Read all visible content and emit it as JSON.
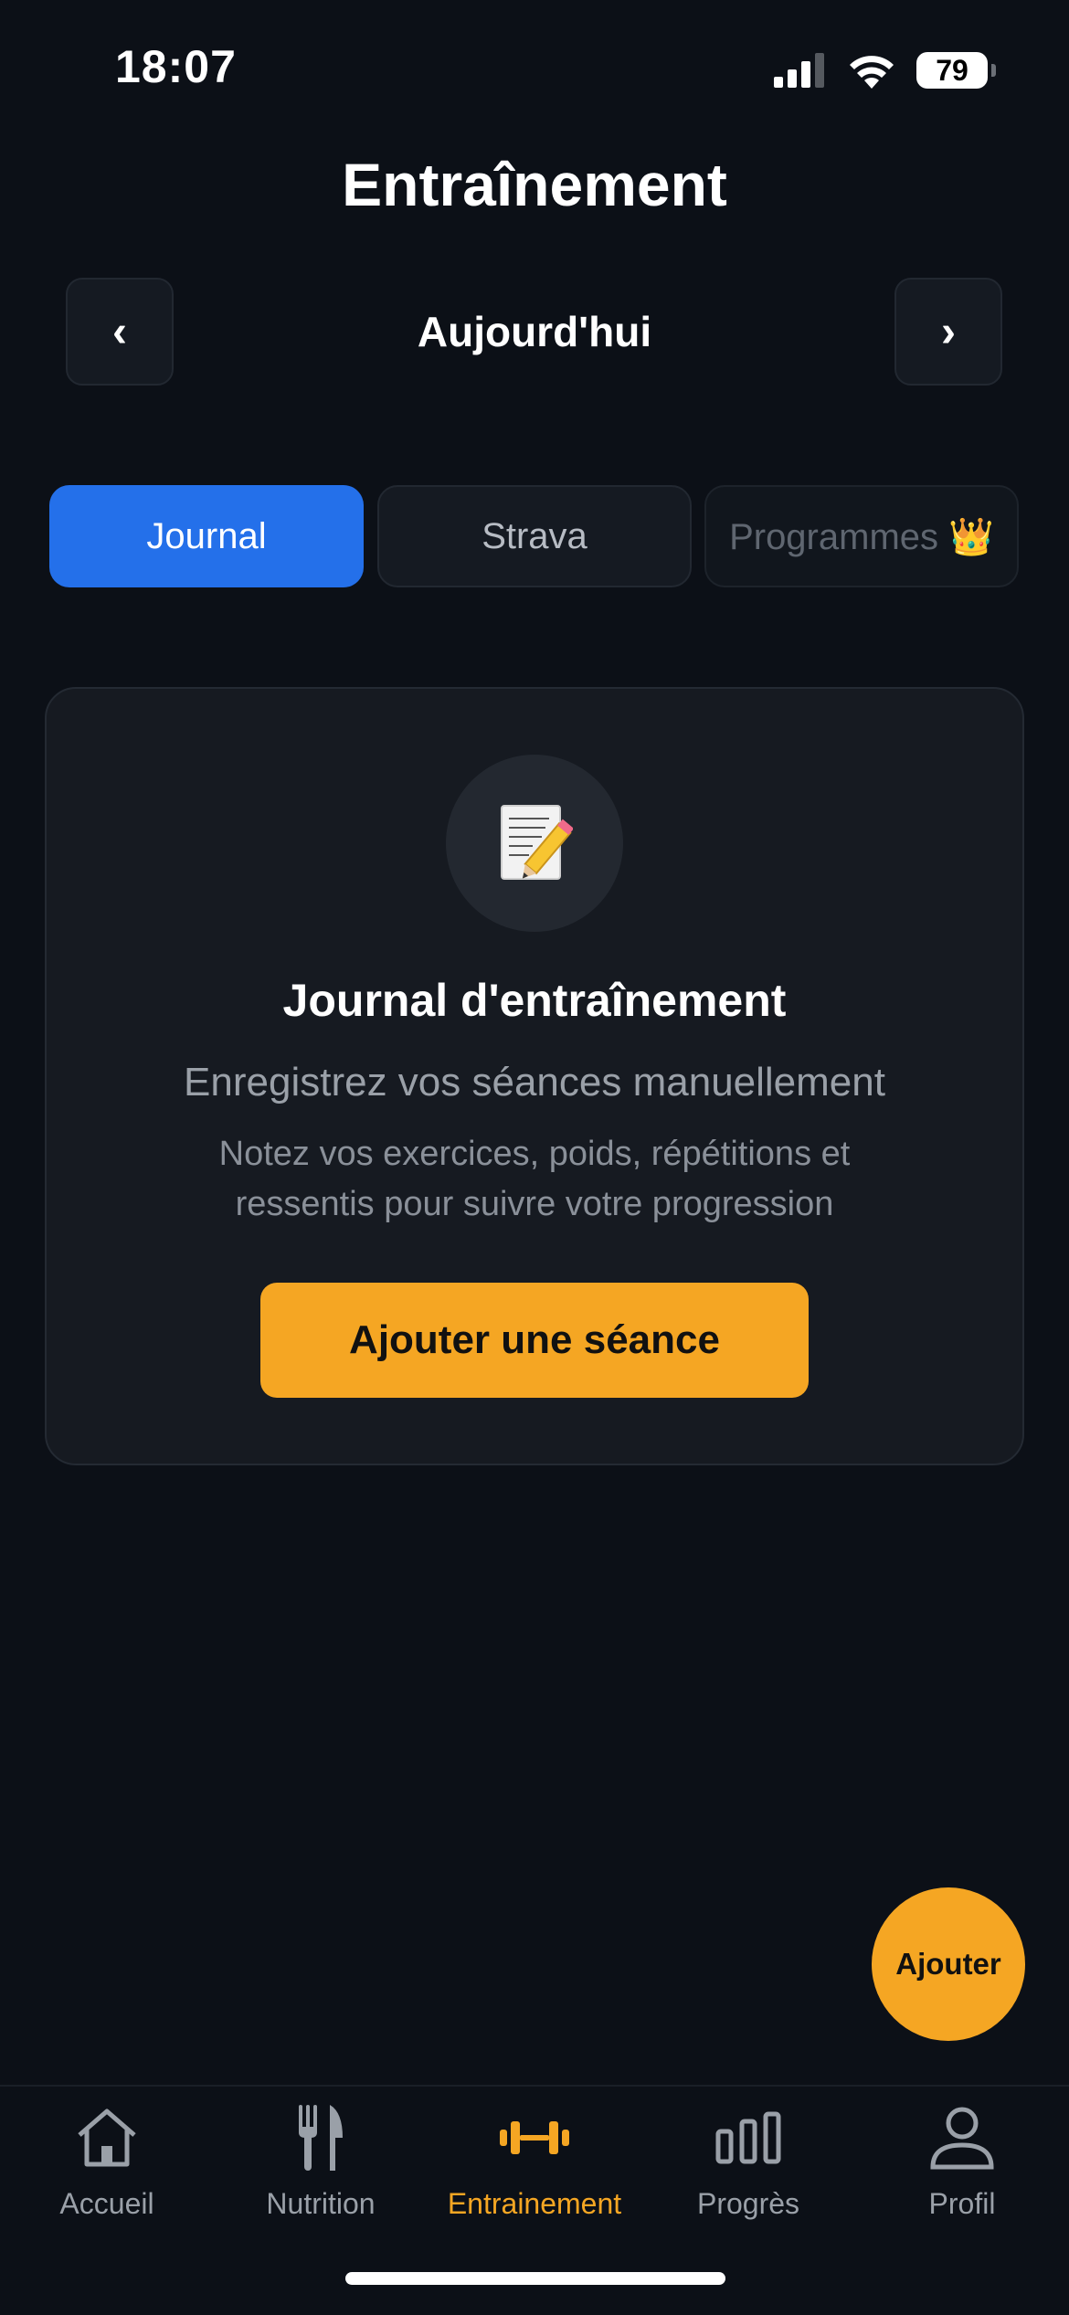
{
  "status_bar": {
    "time": "18:07",
    "battery": "79"
  },
  "header": {
    "title": "Entraînement"
  },
  "date_nav": {
    "prev": "‹",
    "label": "Aujourd'hui",
    "next": "›"
  },
  "tabs": [
    {
      "label": "Journal",
      "active": true
    },
    {
      "label": "Strava",
      "active": false
    },
    {
      "label": "Programmes 👑",
      "active": false,
      "locked": true
    }
  ],
  "card": {
    "emoji": "📝",
    "title": "Journal d'entraînement",
    "subtitle": "Enregistrez vos séances manuellement",
    "description_line1": "Notez vos exercices, poids, répétitions et",
    "description_line2": "ressentis pour suivre votre progression",
    "cta": "Ajouter une séance"
  },
  "fab": {
    "label": "Ajouter"
  },
  "bottom_nav": [
    {
      "label": "Accueil",
      "icon": "home-icon",
      "active": false
    },
    {
      "label": "Nutrition",
      "icon": "fork-knife-icon",
      "active": false
    },
    {
      "label": "Entrainement",
      "icon": "dumbbell-icon",
      "active": true
    },
    {
      "label": "Progrès",
      "icon": "bar-chart-icon",
      "active": false
    },
    {
      "label": "Profil",
      "icon": "user-icon",
      "active": false
    }
  ],
  "colors": {
    "accent": "#f5a623",
    "primary": "#2470ea",
    "background": "#0c1017"
  }
}
